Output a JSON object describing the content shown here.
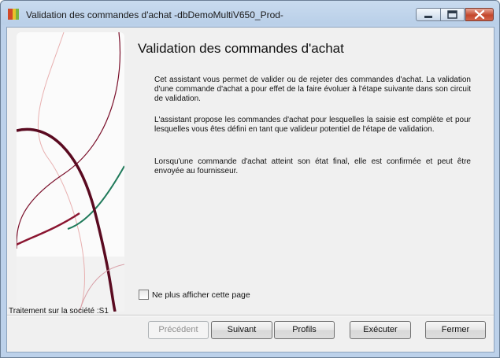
{
  "window": {
    "title": "Validation des commandes d'achat -dbDemoMultiV650_Prod-",
    "controls": [
      "minimize-icon",
      "maximize-icon",
      "close-icon"
    ]
  },
  "main": {
    "title": "Validation des commandes d'achat",
    "paragraphs": [
      "Cet assistant vous permet de valider ou de rejeter des commandes d'achat. La validation d'une commande d'achat a pour effet de la faire évoluer à l'étape suivante dans son circuit de validation.",
      "L'assistant propose les commandes d'achat pour lesquelles la saisie est complète et pour lesquelles vous êtes défini en tant que valideur potentiel de l'étape de validation.",
      "Lorsqu'une commande d'achat atteint son état final, elle est confirmée et peut être envoyée au fournisseur."
    ],
    "checkbox": {
      "label": "Ne plus afficher cette page",
      "checked": false
    }
  },
  "footer": {
    "company": "Traitement sur la société :S1"
  },
  "buttons": {
    "previous": "Précédent",
    "next": "Suivant",
    "profiles": "Profils",
    "execute": "Exécuter",
    "close": "Fermer"
  },
  "colors": {
    "title_bar": "#b9cfe8",
    "client_bg": "#f0f0f0",
    "wave_dark_red": "#7a0f2a",
    "wave_green": "#1f7a5a",
    "close_button": "#c4472c"
  }
}
